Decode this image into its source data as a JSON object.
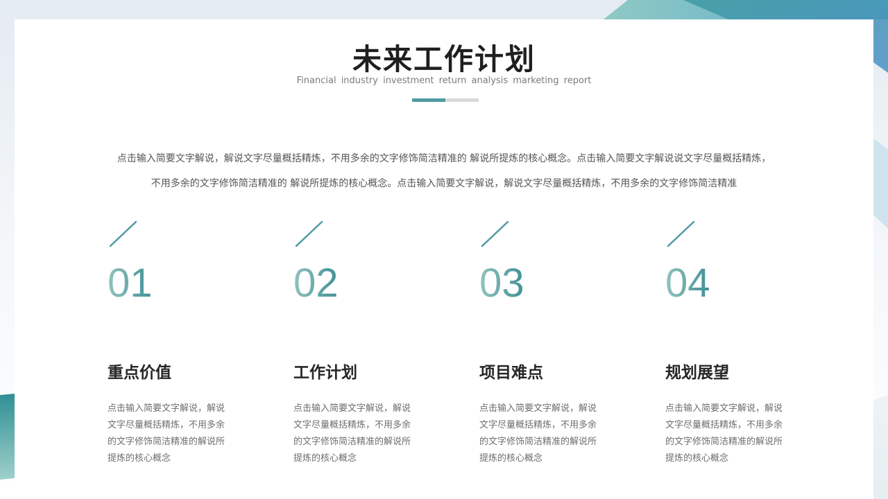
{
  "slide": {
    "title": "未来工作计划",
    "subtitle": "Financial industry investment return analysis marketing report",
    "intro_line_1": "点击输入简要文字解说，解说文字尽量概括精炼，不用多余的文字修饰简洁精准的 解说所提炼的核心概念。点击输入简要文字解说说文字尽量概括精炼，",
    "intro_line_2": "不用多余的文字修饰简洁精准的 解说所提炼的核心概念。点击输入简要文字解说，解说文字尽量概括精炼，不用多余的文字修饰简洁精准",
    "columns": [
      {
        "number": "01",
        "title": "重点价值",
        "text": "点击输入简要文字解说，解说文字尽量概括精炼，不用多余的文字修饰简洁精准的解说所提炼的核心概念"
      },
      {
        "number": "02",
        "title": "工作计划",
        "text": "点击输入简要文字解说，解说文字尽量概括精炼，不用多余的文字修饰简洁精准的解说所提炼的核心概念"
      },
      {
        "number": "03",
        "title": "项目难点",
        "text": "点击输入简要文字解说，解说文字尽量概括精炼，不用多余的文字修饰简洁精准的解说所提炼的核心概念"
      },
      {
        "number": "04",
        "title": "规划展望",
        "text": "点击输入简要文字解说，解说文字尽量概括精炼，不用多余的文字修饰简洁精准的解说所提炼的核心概念"
      }
    ]
  },
  "colors": {
    "accent": "#4e9aa3",
    "accent_light": "#92c3bc",
    "title": "#1f1f1f",
    "body_text": "#6e6e6e"
  }
}
